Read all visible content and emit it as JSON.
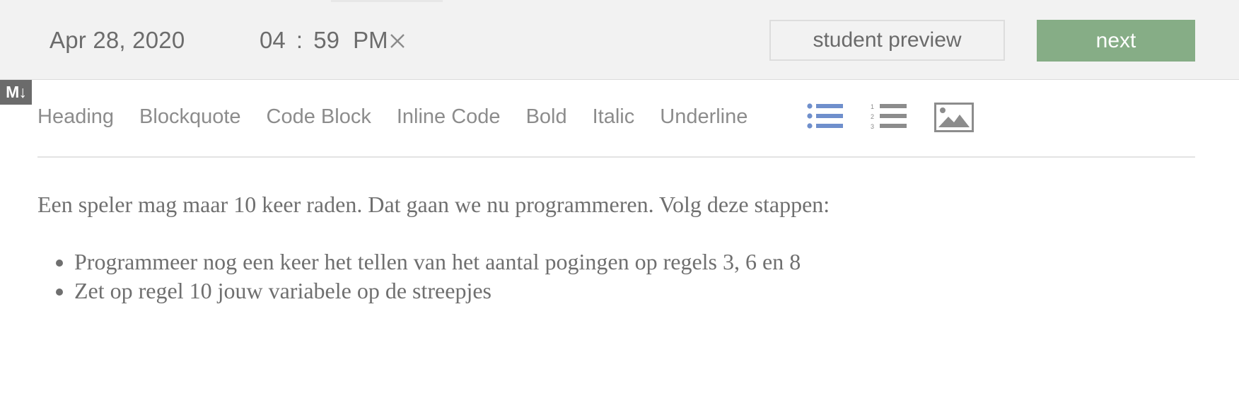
{
  "header": {
    "date": "Apr 28, 2020",
    "time": {
      "hours": "04",
      "separator": ":",
      "minutes": "59",
      "meridiem": "PM"
    },
    "clear_icon": "close-icon",
    "preview_label": "student preview",
    "next_label": "next"
  },
  "editor": {
    "markdown_badge": "M↓",
    "toolbar": {
      "heading": "Heading",
      "blockquote": "Blockquote",
      "code_block": "Code Block",
      "inline_code": "Inline Code",
      "bold": "Bold",
      "italic": "Italic",
      "underline": "Underline",
      "icons": [
        "bullet-list-icon",
        "numbered-list-icon",
        "image-icon"
      ]
    },
    "content": {
      "paragraph": "Een speler mag maar 10 keer raden. Dat gaan we nu programmeren. Volg deze stappen:",
      "items": [
        "Programmeer nog een keer het tellen van het aantal pogingen op regels 3, 6 en 8",
        "Zet op regel 10 jouw variabele op de streepjes"
      ]
    }
  },
  "colors": {
    "next_button": "#86ad86",
    "bullet_list_icon": "#6f8fcc",
    "toolbar_text": "#8c8c8c"
  }
}
